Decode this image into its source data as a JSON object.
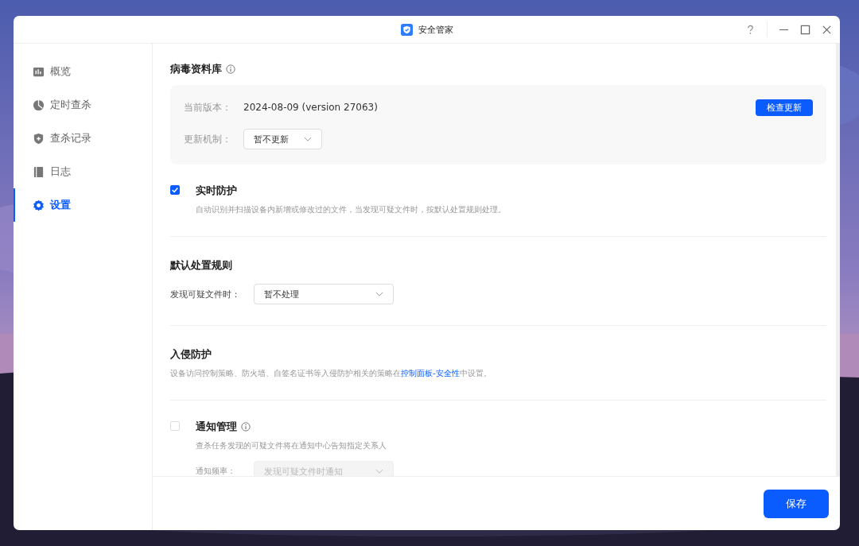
{
  "window": {
    "title": "安全管家"
  },
  "sidebar": {
    "items": [
      {
        "label": "概览",
        "kind": "chart",
        "selected": false
      },
      {
        "label": "定时查杀",
        "kind": "clock",
        "selected": false
      },
      {
        "label": "查杀记录",
        "kind": "shield",
        "selected": false
      },
      {
        "label": "日志",
        "kind": "book",
        "selected": false
      },
      {
        "label": "设置",
        "kind": "gear",
        "selected": true
      }
    ]
  },
  "virus_db": {
    "title": "病毒资料库",
    "version_label": "当前版本：",
    "version_value": "2024-08-09 (version 27063)",
    "check_button": "检查更新",
    "update_label": "更新机制：",
    "update_select": "暂不更新"
  },
  "realtime": {
    "checked": true,
    "title": "实时防护",
    "description": "自动识别并扫描设备内新增或修改过的文件，当发现可疑文件时，按默认处置规则处理。"
  },
  "default_rule": {
    "title": "默认处置规则",
    "label": "发现可疑文件时：",
    "select": "暂不处理"
  },
  "intrusion": {
    "title": "入侵防护",
    "text_before": "设备访问控制策略、防火墙、自签名证书等入侵防护相关的策略在",
    "link": "控制面板-安全性",
    "text_after": "中设置。"
  },
  "notification": {
    "checked": false,
    "title": "通知管理",
    "description": "查杀任务发现的可疑文件将在通知中心告知指定关系人",
    "frequency_label": "通知频率：",
    "frequency_select": "发现可疑文件时通知",
    "disabled": true
  },
  "save_button": "保存"
}
